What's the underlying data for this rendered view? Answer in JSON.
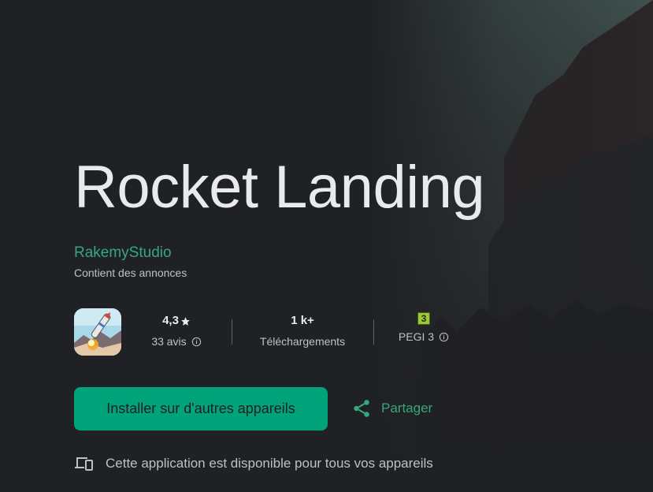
{
  "app": {
    "title": "Rocket Landing",
    "developer": "RakemyStudio",
    "ads_note": "Contient des annonces"
  },
  "stats": {
    "rating": {
      "value": "4,3",
      "label": "33 avis",
      "icon": "star-icon"
    },
    "downloads": {
      "value": "1 k+",
      "label": "Téléchargements"
    },
    "pegi": {
      "badge": "3",
      "label": "PEGI 3"
    }
  },
  "actions": {
    "install_label": "Installer sur d'autres appareils",
    "share_label": "Partager"
  },
  "devices_note": "Cette application est disponible pour tous vos appareils",
  "colors": {
    "background": "#202124",
    "accent": "#01a37a",
    "link": "#34a87c",
    "text_primary": "#e8eaed",
    "text_secondary": "#bdc1c6"
  }
}
